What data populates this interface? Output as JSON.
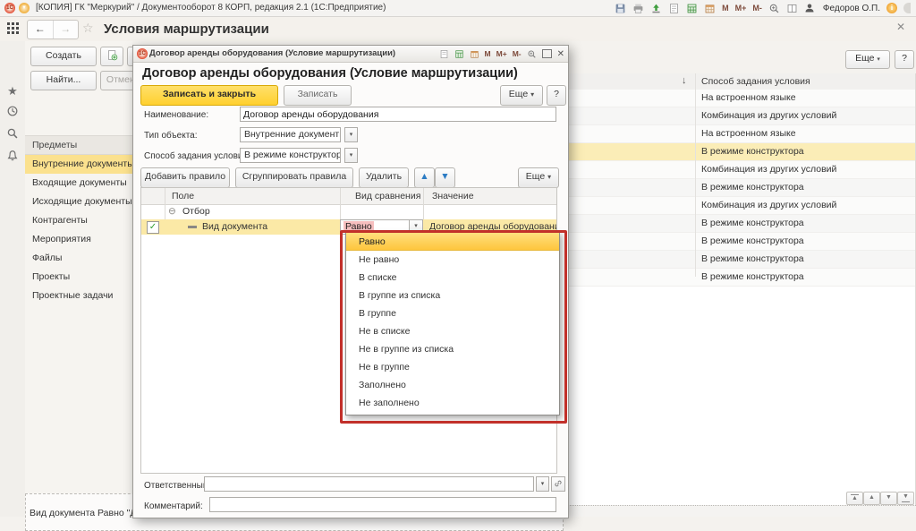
{
  "titlebar": {
    "title": "[КОПИЯ] ГК \"Меркурий\" / Документооборот 8 КОРП, редакция 2.1   (1С:Предприятие)",
    "user": "Федоров О.П.",
    "m_icons": [
      "M",
      "M+",
      "M-"
    ]
  },
  "page": {
    "title": "Условия маршрутизации"
  },
  "sidebar": {
    "buttons": {
      "create": "Создать",
      "find": "Найти",
      "find_ellipsis": "Найти...",
      "cancel_search": "Отменить поиск"
    },
    "group_header": "Предметы",
    "items": [
      "Внутренние документы",
      "Входящие документы",
      "Исходящие документы",
      "Контрагенты",
      "Мероприятия",
      "Файлы",
      "Проекты",
      "Проектные задачи"
    ],
    "selected_index": 0
  },
  "list": {
    "more_button": "Еще",
    "help_button": "?",
    "sort_icon": "↓",
    "column_header": "Способ задания условия",
    "rows": [
      "На встроенном языке",
      "Комбинация из других условий",
      "На встроенном языке",
      "В режиме конструктора",
      "Комбинация из других условий",
      "В режиме конструктора",
      "Комбинация из других условий",
      "В режиме конструктора",
      "В режиме конструктора",
      "В режиме конструктора",
      "В режиме конструктора"
    ],
    "selected_index": 3,
    "footer_preview": "Вид документа Равно \"Дого"
  },
  "dialog": {
    "window_title": "Договор аренды оборудования (Условие маршрутизации)",
    "heading": "Договор аренды оборудования (Условие маршрутизации)",
    "buttons": {
      "save_close": "Записать и закрыть",
      "save": "Записать",
      "more": "Еще",
      "help": "?"
    },
    "fields": {
      "name_label": "Наименование:",
      "name_value": "Договор аренды оборудования",
      "type_label": "Тип объекта:",
      "type_value": "Внутренние документы",
      "method_label": "Способ задания условия:",
      "method_value": "В режиме конструктора",
      "responsible_label": "Ответственный:",
      "responsible_value": "",
      "comment_label": "Комментарий:",
      "comment_value": ""
    },
    "rules_toolbar": {
      "add": "Добавить правило",
      "group": "Сгруппировать правила",
      "delete": "Удалить",
      "more": "Еще"
    },
    "table": {
      "columns": [
        "Поле",
        "Вид сравнения",
        "Значение"
      ],
      "group_row": "Отбор",
      "row": {
        "checked": true,
        "field": "Вид документа",
        "comparison": "Равно",
        "value": "Договор аренды оборудования"
      }
    },
    "dropdown": {
      "options": [
        "Равно",
        "Не равно",
        "В списке",
        "В группе из списка",
        "В группе",
        "Не в списке",
        "Не в группе из списка",
        "Не в группе",
        "Заполнено",
        "Не заполнено"
      ],
      "selected_index": 0
    }
  }
}
